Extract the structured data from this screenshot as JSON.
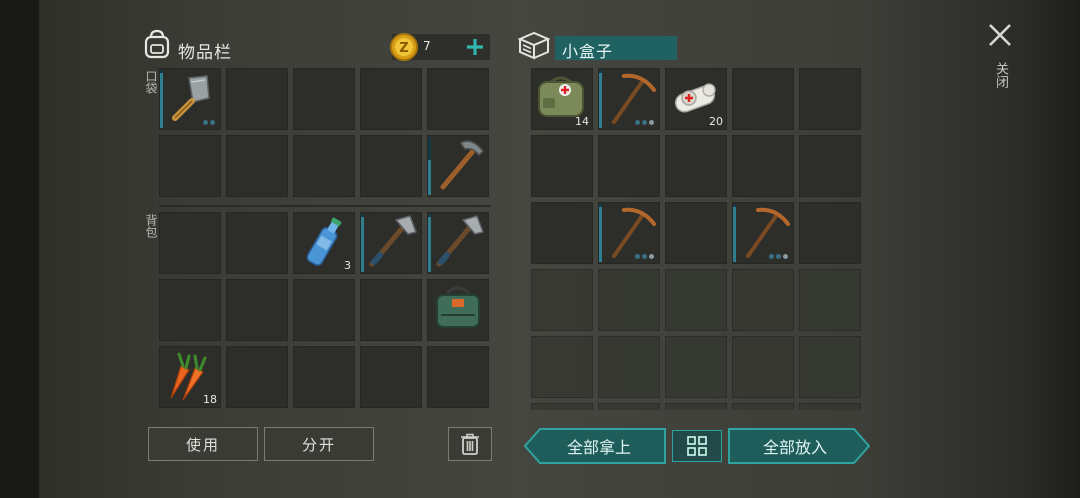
{
  "inventory": {
    "title": "物品栏",
    "coins": "7",
    "pocket_label": "口袋",
    "backpack_label": "背包",
    "pocket": [
      {
        "item": "cleaver",
        "durability": 0.95,
        "dots": 2
      },
      {
        "item": null
      },
      {
        "item": null
      },
      {
        "item": null
      },
      {
        "item": null
      },
      {
        "item": null
      },
      {
        "item": null
      },
      {
        "item": null
      },
      {
        "item": null
      },
      {
        "item": "stone-hammer",
        "durability": 0.6
      }
    ],
    "backpack": [
      {
        "item": null
      },
      {
        "item": null
      },
      {
        "item": "water-bottle",
        "qty": "3"
      },
      {
        "item": "hatchet",
        "durability": 0.95
      },
      {
        "item": "hatchet",
        "durability": 0.95
      },
      {
        "item": null
      },
      {
        "item": null
      },
      {
        "item": null
      },
      {
        "item": null
      },
      {
        "item": "green-bag"
      },
      {
        "item": "carrots",
        "qty": "18"
      },
      {
        "item": null
      },
      {
        "item": null
      },
      {
        "item": null
      },
      {
        "item": null
      }
    ]
  },
  "container": {
    "title": "小盒子",
    "slots": [
      {
        "item": "first-aid-bag",
        "qty": "14"
      },
      {
        "item": "pickaxe",
        "durability": 0.95,
        "dots": 3
      },
      {
        "item": "bandage",
        "qty": "20"
      },
      {
        "item": null
      },
      {
        "item": null
      },
      {
        "item": null
      },
      {
        "item": null
      },
      {
        "item": null
      },
      {
        "item": null
      },
      {
        "item": null
      },
      {
        "item": null
      },
      {
        "item": "pickaxe",
        "durability": 0.95,
        "dots": 3
      },
      {
        "item": null
      },
      {
        "item": "pickaxe",
        "durability": 0.95,
        "dots": 3
      },
      {
        "item": null
      },
      {
        "item": null,
        "dim": true
      },
      {
        "item": null,
        "dim": true
      },
      {
        "item": null,
        "dim": true
      },
      {
        "item": null,
        "dim": true
      },
      {
        "item": null,
        "dim": true
      },
      {
        "item": null,
        "dim": true
      },
      {
        "item": null,
        "dim": true
      },
      {
        "item": null,
        "dim": true
      },
      {
        "item": null,
        "dim": true
      },
      {
        "item": null,
        "dim": true
      },
      {
        "item": null,
        "dim": true
      },
      {
        "item": null,
        "dim": true
      },
      {
        "item": null,
        "dim": true
      },
      {
        "item": null,
        "dim": true
      },
      {
        "item": null,
        "dim": true
      }
    ]
  },
  "buttons": {
    "use": "使用",
    "split": "分开",
    "take_all": "全部拿上",
    "put_all": "全部放入",
    "close": "关闭"
  },
  "colors": {
    "accent_teal": "#2fa3a0",
    "teal_fill": "#1e5d5a",
    "durability_blue": "#2f7f93"
  }
}
